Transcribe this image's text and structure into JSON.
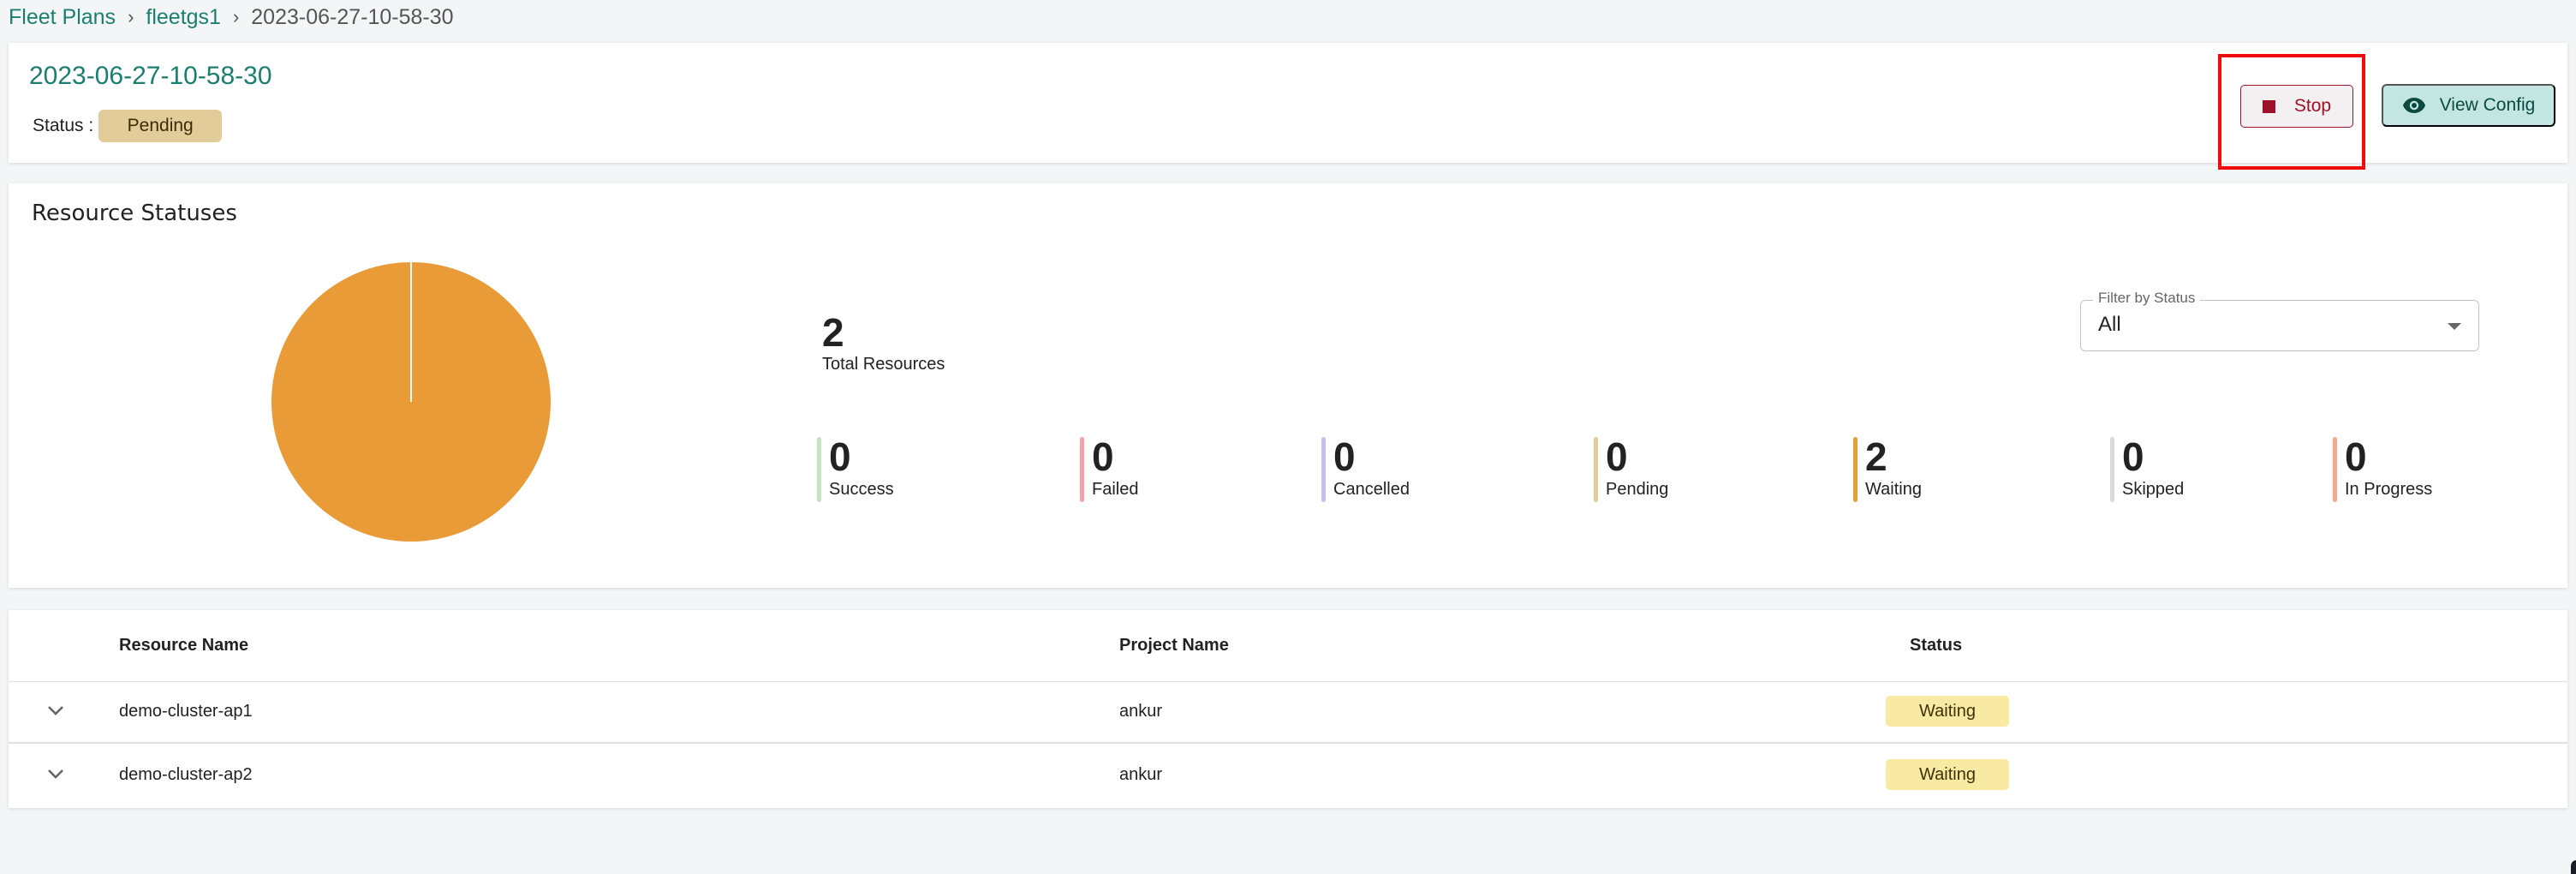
{
  "breadcrumb": {
    "items": [
      {
        "label": "Fleet Plans"
      },
      {
        "label": "fleetgs1"
      },
      {
        "label": "2023-06-27-10-58-30"
      }
    ],
    "separator": "›"
  },
  "header": {
    "title": "2023-06-27-10-58-30",
    "status_label": "Status :",
    "status_value": "Pending",
    "stop_label": "Stop",
    "view_config_label": "View Config"
  },
  "resource_statuses": {
    "title": "Resource Statuses",
    "total": {
      "value": "2",
      "label": "Total Resources"
    },
    "stats": [
      {
        "label": "Success",
        "value": "0",
        "color": "#c5e3c3"
      },
      {
        "label": "Failed",
        "value": "0",
        "color": "#f5a1ad"
      },
      {
        "label": "Cancelled",
        "value": "0",
        "color": "#c1c1f7"
      },
      {
        "label": "Pending",
        "value": "0",
        "color": "#e2cc9a"
      },
      {
        "label": "Waiting",
        "value": "2",
        "color": "#e89b36"
      },
      {
        "label": "Skipped",
        "value": "0",
        "color": "#dadada"
      },
      {
        "label": "In Progress",
        "value": "0",
        "color": "#f5aa8f"
      }
    ],
    "filter": {
      "label": "Filter by Status",
      "value": "All"
    }
  },
  "chart_data": {
    "type": "pie",
    "title": "",
    "categories": [
      "Success",
      "Failed",
      "Cancelled",
      "Pending",
      "Waiting",
      "Skipped",
      "In Progress"
    ],
    "values": [
      0,
      0,
      0,
      0,
      2,
      0,
      0
    ],
    "colors": [
      "#c5e3c3",
      "#f5a1ad",
      "#c1c1f7",
      "#e2cc9a",
      "#e89b36",
      "#dadada",
      "#f5aa8f"
    ],
    "legend": "none"
  },
  "table": {
    "columns": [
      "Resource Name",
      "Project Name",
      "Status"
    ],
    "rows": [
      {
        "resource_name": "demo-cluster-ap1",
        "project_name": "ankur",
        "status": "Waiting"
      },
      {
        "resource_name": "demo-cluster-ap2",
        "project_name": "ankur",
        "status": "Waiting"
      }
    ]
  }
}
